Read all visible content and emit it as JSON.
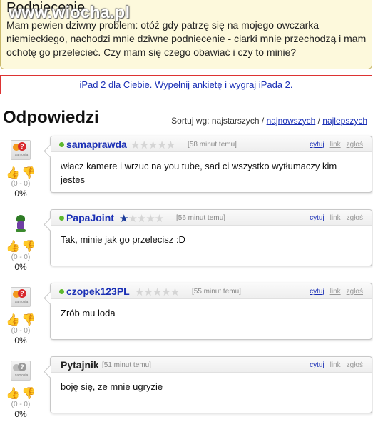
{
  "watermark": "www.wiocha.pl",
  "question": {
    "title": "Podniecenie",
    "body": "Mam pewien dziwny problem: otóż gdy patrzę się na mojego owczarka niemieckiego, nachodzi mnie dziwne podniecenie - ciarki mnie przechodzą i mam ochotę go przelecieć. Czy mam się czego obawiać i czy to minie?"
  },
  "ad": {
    "text": "iPad 2 dla Ciebie. Wypełnij ankietę i wygraj iPada 2."
  },
  "answers_header": {
    "title": "Odpowiedzi",
    "sort_label": "Sortuj wg:",
    "sort_oldest": "najstarszych",
    "sort_sep1": " / ",
    "sort_newest": "najnowszych",
    "sort_sep2": " / ",
    "sort_best": "najlepszych"
  },
  "actions": {
    "cite": "cytuj",
    "link": "link",
    "report": "zgłoś"
  },
  "answers": [
    {
      "user": "samaprawda",
      "rating": 0,
      "time": "[58 minut temu]",
      "text": "włacz kamere i wrzuc na you tube, sad ci wszystko wytłumaczy kim jestes",
      "votes": "(0 - 0)",
      "percent": "0%",
      "avatar": "samosia-icon"
    },
    {
      "user": "PapaJoint",
      "rating": 0.5,
      "time": "[56 minut temu]",
      "text": "Tak, minie jak go przelecisz :D",
      "votes": "(0 - 0)",
      "percent": "0%",
      "avatar": "pot-character-icon"
    },
    {
      "user": "czopek123PL",
      "rating": 0,
      "time": "[55 minut temu]",
      "text": "Zrób mu loda",
      "votes": "(0 - 0)",
      "percent": "0%",
      "avatar": "samosia-icon"
    },
    {
      "user": "Pytajnik",
      "rating": null,
      "time": "[51 minut temu]",
      "text": "boję się, ze mnie ugryzie",
      "votes": "(0 - 0)",
      "percent": "0%",
      "avatar": "samosia-gray-icon"
    }
  ],
  "colors": {
    "question_bg": "#fdf9dc",
    "link": "#1a2fb5",
    "online": "#5db82e",
    "thumb_up": "#d9259a",
    "thumb_down": "#e0b300"
  }
}
